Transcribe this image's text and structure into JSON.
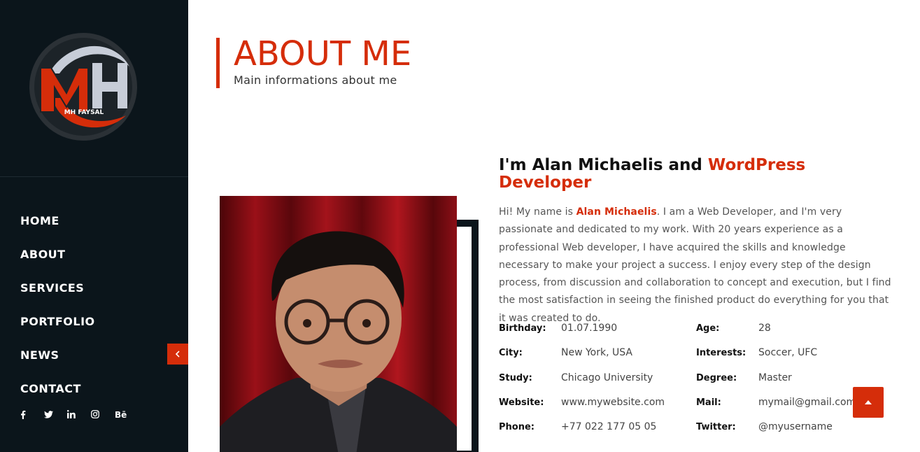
{
  "colors": {
    "accent": "#d52d0a",
    "sidebar_bg": "#0b151b",
    "text_dark": "#111111"
  },
  "logo": {
    "text": "MH FAYSAL"
  },
  "nav": {
    "items": [
      {
        "label": "HOME"
      },
      {
        "label": "ABOUT"
      },
      {
        "label": "SERVICES"
      },
      {
        "label": "PORTFOLIO"
      },
      {
        "label": "NEWS"
      },
      {
        "label": "CONTACT"
      }
    ],
    "collapse_icon": "chevron-left-icon"
  },
  "social": [
    {
      "icon": "facebook-icon",
      "glyph": "f"
    },
    {
      "icon": "twitter-icon",
      "glyph": "t"
    },
    {
      "icon": "linkedin-icon",
      "glyph": "in"
    },
    {
      "icon": "instagram-icon",
      "glyph": "ig"
    },
    {
      "icon": "behance-icon",
      "glyph": "Bē"
    }
  ],
  "header": {
    "title": "ABOUT ME",
    "subtitle": "Main informations about me"
  },
  "intro": {
    "title_prefix": "I'm Alan Michaelis and ",
    "title_accent": "WordPress Developer",
    "text_before": "Hi! My name is ",
    "name": "Alan Michaelis",
    "text_after": ". I am a Web Developer, and I'm very passionate and dedicated to my work. With 20 years experience as a professional Web developer, I have acquired the skills and knowledge necessary to make your project a success. I enjoy every step of the design process, from discussion and collaboration to concept and execution, but I find the most satisfaction in seeing the finished product do everything for you that it was created to do."
  },
  "info": {
    "left": [
      {
        "label": "Birthday:",
        "value": "01.07.1990"
      },
      {
        "label": "City:",
        "value": "New York, USA"
      },
      {
        "label": "Study:",
        "value": "Chicago University"
      },
      {
        "label": "Website:",
        "value": "www.mywebsite.com"
      },
      {
        "label": "Phone:",
        "value": "+77 022 177 05 05"
      }
    ],
    "right": [
      {
        "label": "Age:",
        "value": "28"
      },
      {
        "label": "Interests:",
        "value": "Soccer, UFC"
      },
      {
        "label": "Degree:",
        "value": "Master"
      },
      {
        "label": "Mail:",
        "value": "mymail@gmail.com"
      },
      {
        "label": "Twitter:",
        "value": "@myusername"
      }
    ]
  },
  "scroll_top_icon": "arrow-up-icon"
}
